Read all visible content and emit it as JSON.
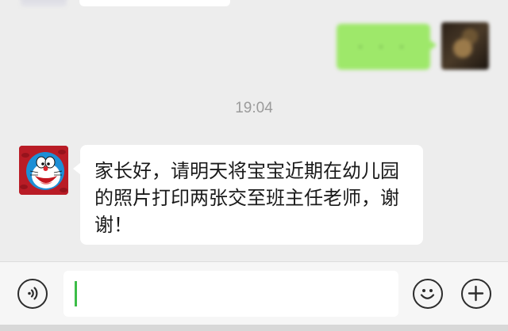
{
  "conversation": {
    "previous_message": {
      "from": "other"
    },
    "sent_message": {
      "from": "me",
      "text": "· · ·",
      "blurred": true,
      "bubble_color": "#9ee86a"
    },
    "timestamp": "19:04",
    "received_message": {
      "from": "other",
      "avatar": "doraemon-avatar",
      "text": "家长好，请明天将宝宝近期在幼儿园的照片打印两张交至班主任老师，谢谢！",
      "bubble_color": "#ffffff"
    }
  },
  "input_bar": {
    "voice_icon": "voice-icon",
    "input_value": "",
    "input_placeholder": "",
    "emoji_icon": "emoji-icon",
    "plus_icon": "plus-icon",
    "caret_color": "#3cbd48"
  },
  "colors": {
    "background": "#ededed",
    "sent_bubble": "#9ee86a",
    "received_bubble": "#ffffff",
    "timestamp_text": "#9b9b9b"
  }
}
